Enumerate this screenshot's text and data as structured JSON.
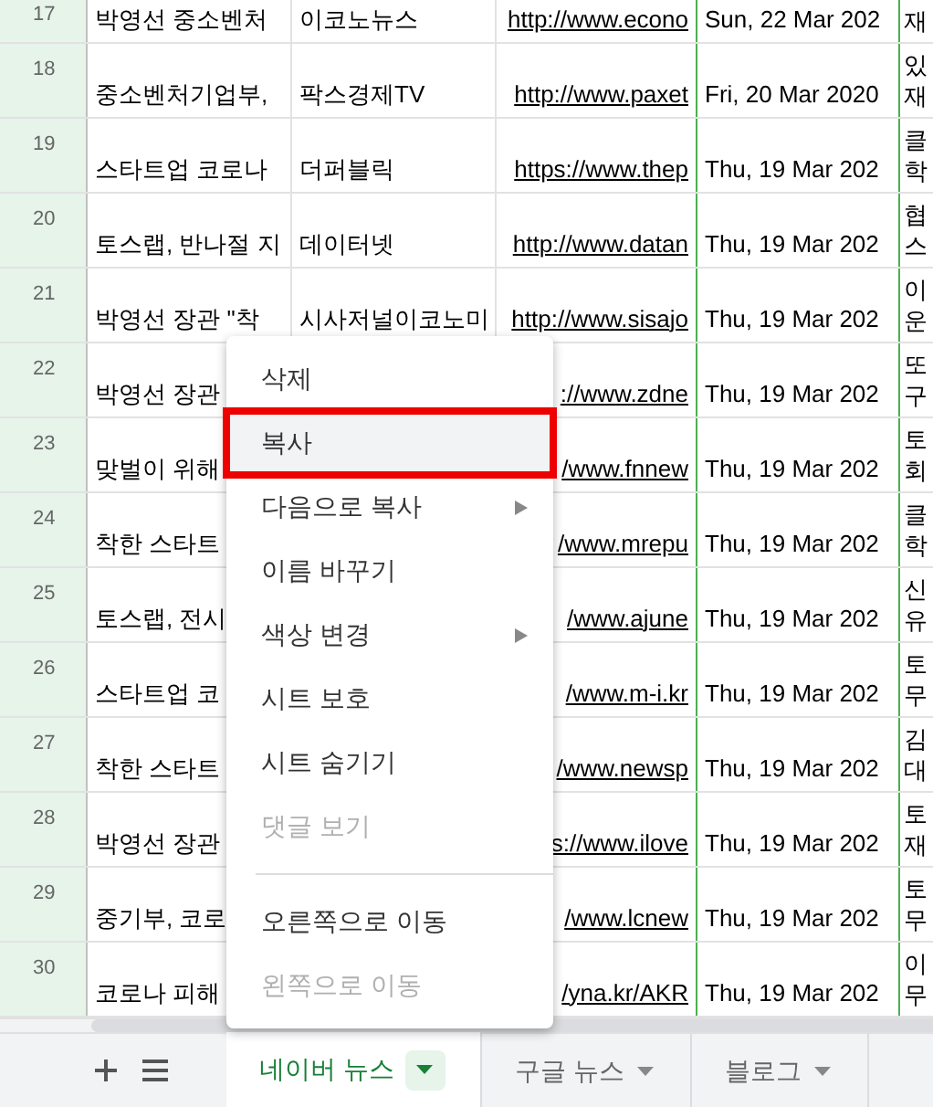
{
  "rows": [
    {
      "number": "17",
      "title": "박영선 중소벤처",
      "source": "이코노뉴스",
      "link": "http://www.econo",
      "date": "Sun, 22 Mar 202",
      "note": [
        "재"
      ]
    },
    {
      "number": "18",
      "title": "중소벤처기업부,",
      "source": "팍스경제TV",
      "link": "http://www.paxet",
      "date": "Fri, 20 Mar 2020",
      "note": [
        "있",
        "재"
      ]
    },
    {
      "number": "19",
      "title": "스타트업 코로나",
      "source": "더퍼블릭",
      "link": "https://www.thep",
      "date": "Thu, 19 Mar 202",
      "note": [
        "클",
        "학"
      ]
    },
    {
      "number": "20",
      "title": "토스랩, 반나절 지",
      "source": "데이터넷",
      "link": "http://www.datan",
      "date": "Thu, 19 Mar 202",
      "note": [
        "협",
        "스"
      ]
    },
    {
      "number": "21",
      "title": "박영선 장관 \"착",
      "source": "시사저널이코노미",
      "link": "http://www.sisajo",
      "date": "Thu, 19 Mar 202",
      "note": [
        "이",
        "운"
      ]
    },
    {
      "number": "22",
      "title": "박영선 장관",
      "link": "://www.zdne",
      "date": "Thu, 19 Mar 202",
      "note": [
        "또",
        "구"
      ]
    },
    {
      "number": "23",
      "title": "맞벌이 위해",
      "link": "/www.fnnew",
      "date": "Thu, 19 Mar 202",
      "note": [
        "토",
        "회"
      ]
    },
    {
      "number": "24",
      "title": "착한 스타트",
      "link": "/www.mrepu",
      "date": "Thu, 19 Mar 202",
      "note": [
        "클",
        "학"
      ]
    },
    {
      "number": "25",
      "title": "토스랩, 전시",
      "link": "/www.ajune",
      "date": "Thu, 19 Mar 202",
      "note": [
        "신",
        "유"
      ]
    },
    {
      "number": "26",
      "title": "스타트업 코",
      "link": "/www.m-i.kr",
      "date": "Thu, 19 Mar 202",
      "note": [
        "토",
        "무"
      ]
    },
    {
      "number": "27",
      "title": "착한 스타트",
      "link": "/www.newsp",
      "date": "Thu, 19 Mar 202",
      "note": [
        "김",
        "대"
      ]
    },
    {
      "number": "28",
      "title": "박영선 장관",
      "link": "s://www.ilove",
      "date": "Thu, 19 Mar 202",
      "note": [
        "토",
        "재"
      ]
    },
    {
      "number": "29",
      "title": "중기부, 코로",
      "link": "/www.lcnew",
      "date": "Thu, 19 Mar 202",
      "note": [
        "토",
        "무"
      ]
    },
    {
      "number": "30",
      "title": "코로나 피해",
      "link": "/yna.kr/AKR",
      "date": "Thu, 19 Mar 202",
      "note": [
        "이",
        "무"
      ]
    }
  ],
  "context_menu": {
    "items": [
      {
        "kind": "item",
        "label": "삭제",
        "selected": false,
        "disabled": false,
        "submenu": false
      },
      {
        "kind": "item",
        "label": "복사",
        "selected": true,
        "disabled": false,
        "submenu": false
      },
      {
        "kind": "item",
        "label": "다음으로 복사",
        "selected": false,
        "disabled": false,
        "submenu": true
      },
      {
        "kind": "item",
        "label": "이름 바꾸기",
        "selected": false,
        "disabled": false,
        "submenu": false
      },
      {
        "kind": "item",
        "label": "색상 변경",
        "selected": false,
        "disabled": false,
        "submenu": true
      },
      {
        "kind": "item",
        "label": "시트 보호",
        "selected": false,
        "disabled": false,
        "submenu": false
      },
      {
        "kind": "item",
        "label": "시트 숨기기",
        "selected": false,
        "disabled": false,
        "submenu": false
      },
      {
        "kind": "item",
        "label": "댓글 보기",
        "selected": false,
        "disabled": true,
        "submenu": false
      },
      {
        "kind": "divider"
      },
      {
        "kind": "item",
        "label": "오른쪽으로 이동",
        "selected": false,
        "disabled": false,
        "submenu": false
      },
      {
        "kind": "item",
        "label": "왼쪽으로 이동",
        "selected": false,
        "disabled": true,
        "submenu": false
      }
    ]
  },
  "sheet_tabs": [
    {
      "label": "네이버 뉴스",
      "selected": true
    },
    {
      "label": "구글 뉴스",
      "selected": false
    },
    {
      "label": "블로그",
      "selected": false
    }
  ]
}
